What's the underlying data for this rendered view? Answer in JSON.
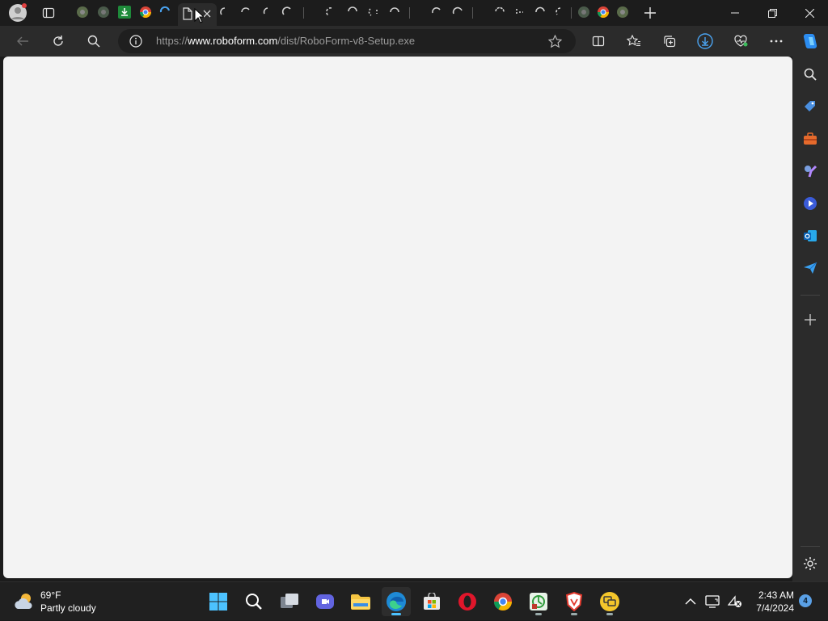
{
  "browser": {
    "address_bar": {
      "url_scheme": "https://",
      "url_host": "www.roboform.com",
      "url_path": "/dist/RoboForm-v8-Setup.exe"
    }
  },
  "taskbar": {
    "weather": {
      "temperature": "69°F",
      "condition": "Partly cloudy"
    },
    "clock": {
      "time": "2:43 AM",
      "date": "7/4/2024"
    },
    "notification_count": "4"
  },
  "colors": {
    "titlebar": "#1c1c1c",
    "toolbar": "#2b2b2b",
    "page_background": "#f3f3f3",
    "taskbar": "#202020",
    "accent": "#5aa0e6"
  }
}
